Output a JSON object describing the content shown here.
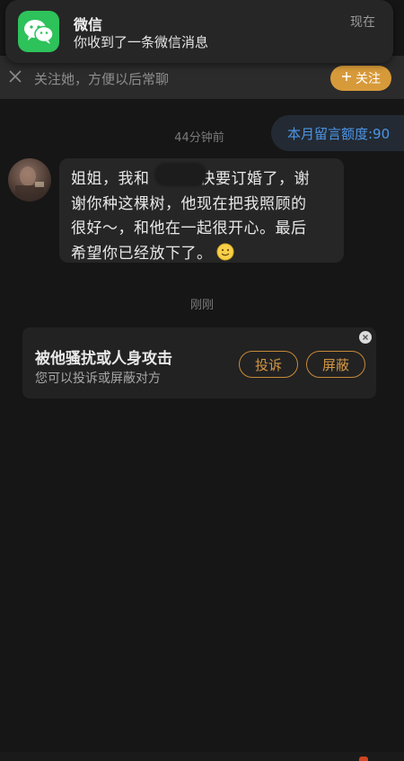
{
  "notification": {
    "app_name": "微信",
    "message": "你收到了一条微信消息",
    "time": "现在",
    "icon": "wechat-icon"
  },
  "follow_bar": {
    "text": "关注她，方便以后常聊",
    "button_label": "关注",
    "close_icon": "close-icon",
    "accent": "#d79a3a"
  },
  "quota": {
    "text": "本月留言额度:90",
    "color": "#4d95e6"
  },
  "chat": {
    "timestamp_1": "44分钟前",
    "message": {
      "line_1": "姐姐，我和",
      "line_1_rest": "快要订婚了，谢",
      "line_2": "谢你种这棵树，他现在把我照顾的",
      "line_3": "很好～，和他在一起很开心。最后",
      "line_4": "希望你已经放下了。",
      "emoji": "smile-emoji"
    },
    "timestamp_2": "刚刚"
  },
  "report_card": {
    "title": "被他骚扰或人身攻击",
    "subtitle": "您可以投诉或屏蔽对方",
    "complain_label": "投诉",
    "block_label": "屏蔽",
    "accent": "#c68a39"
  }
}
